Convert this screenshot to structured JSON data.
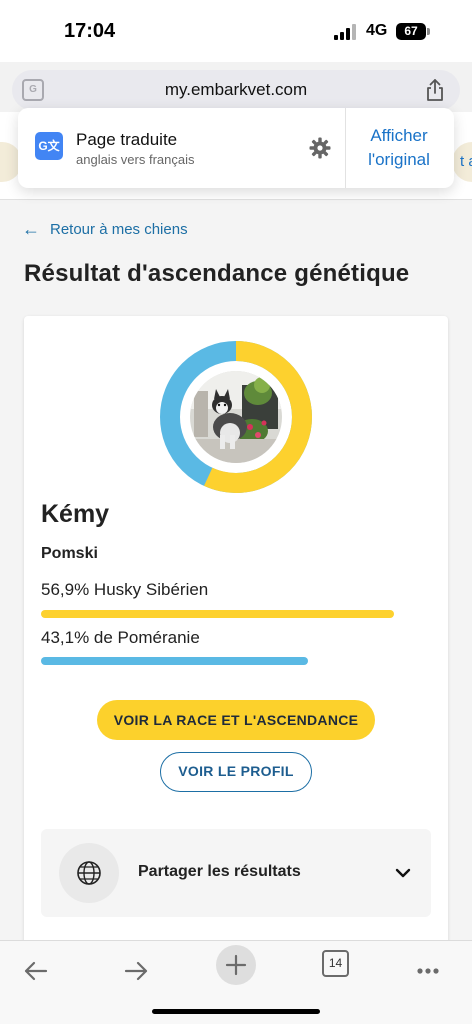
{
  "status_bar": {
    "time": "17:04",
    "network": "4G",
    "battery": "67"
  },
  "browser": {
    "url": "my.embarkvet.com",
    "translate_popup": {
      "title": "Page traduite",
      "subtitle": "anglais vers français",
      "show_original_line1": "Afficher",
      "show_original_line2": "l'original"
    },
    "background_peek_text": "t a",
    "tabs_count": "14"
  },
  "page": {
    "back_link": "Retour à mes chiens",
    "title": "Résultat d'ascendance génétique",
    "dog": {
      "name": "Kémy",
      "breed": "Pomski"
    },
    "ancestry": [
      {
        "label": "56,9% Husky Sibérien",
        "percent": 56.9,
        "color": "#fdd12e"
      },
      {
        "label": "43,1% de Poméranie",
        "percent": 43.1,
        "color": "#5ab9e4"
      }
    ],
    "buttons": {
      "breed_ancestry": "VOIR LA RACE ET L'ASCENDANCE",
      "profile": "VOIR LE PROFIL"
    },
    "share": {
      "label": "Partager les résultats"
    }
  },
  "colors": {
    "accent_yellow": "#fcd12c",
    "accent_blue": "#5ab9e4",
    "link_blue": "#1d6fa5"
  }
}
